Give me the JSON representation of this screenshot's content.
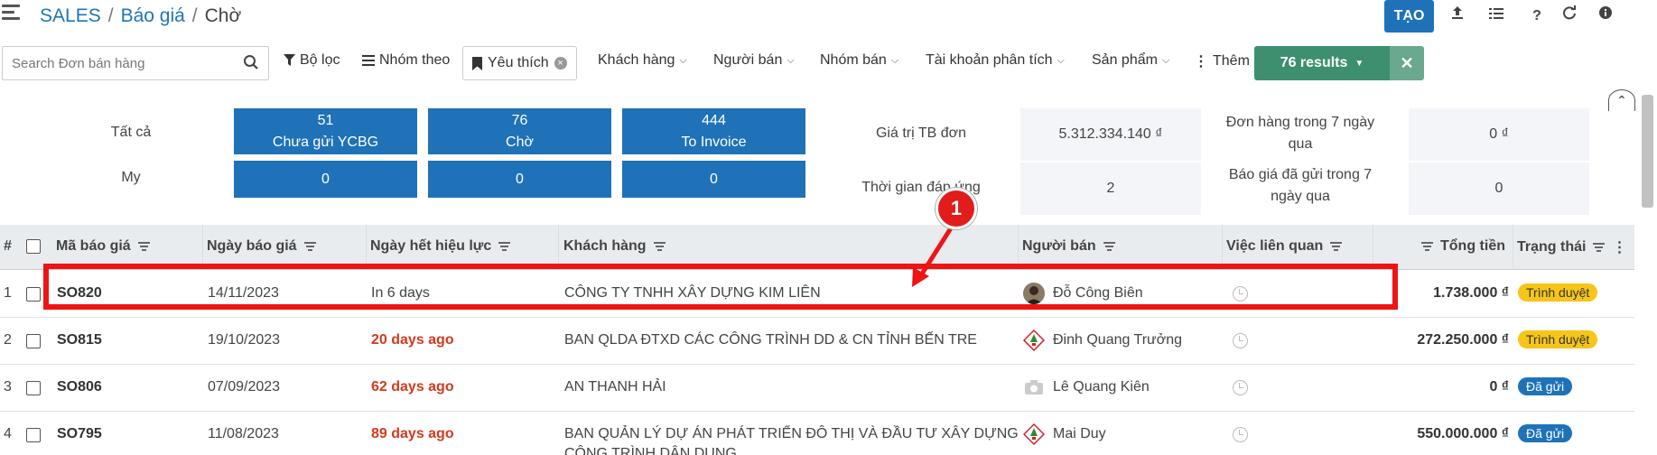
{
  "breadcrumb": {
    "root": "SALES",
    "parent": "Báo giá",
    "current": "Chờ",
    "sep": "/"
  },
  "toolbar": {
    "create_label": "TẠO"
  },
  "search": {
    "placeholder": "Search Đơn bán hàng"
  },
  "filters": {
    "filter_label": "Bộ lọc",
    "group_label": "Nhóm theo",
    "favorite_label": "Yêu thích",
    "customer_label": "Khách hàng",
    "seller_label": "Người bán",
    "team_label": "Nhóm bán",
    "analytic_label": "Tài khoản phân tích",
    "product_label": "Sản phẩm",
    "more_label": "Thêm",
    "results_label": "76 results"
  },
  "dashboard": {
    "row_all": "Tất cả",
    "row_my": "My",
    "tiles": [
      {
        "count": "51",
        "label": "Chưa gửi YCBG",
        "my": "0"
      },
      {
        "count": "76",
        "label": "Chờ",
        "my": "0"
      },
      {
        "count": "444",
        "label": "To Invoice",
        "my": "0"
      }
    ],
    "kpis": [
      {
        "label": "Giá trị TB đơn",
        "value": "5.312.334.140 ₫"
      },
      {
        "label": "Thời gian đáp ứng",
        "value": "2"
      },
      {
        "label_line1": "Đơn hàng trong 7 ngày",
        "label_line2": "qua",
        "value": "0 ₫"
      },
      {
        "label_line1": "Báo giá đã gửi trong 7",
        "label_line2": "ngày qua",
        "value": "0"
      }
    ]
  },
  "table": {
    "headers": {
      "num": "#",
      "code": "Mã báo giá",
      "date": "Ngày báo giá",
      "expiry": "Ngày hết hiệu lực",
      "customer": "Khách hàng",
      "seller": "Người bán",
      "activity": "Việc liên quan",
      "total": "Tổng tiền",
      "status": "Trạng thái"
    },
    "rows": [
      {
        "num": "1",
        "code": "SO820",
        "date": "14/11/2023",
        "expiry": "In 6 days",
        "customer": "CÔNG TY TNHH XÂY DỰNG KIM LIÊN",
        "seller": "Đỗ Công Biên",
        "total": "1.738.000 ₫",
        "status": "Trình duyệt"
      },
      {
        "num": "2",
        "code": "SO815",
        "date": "19/10/2023",
        "expiry": "20 days ago",
        "customer": "BAN QLDA ĐTXD CÁC CÔNG TRÌNH DD & CN TỈNH BẾN TRE",
        "seller": "Đinh Quang Trưởng",
        "total": "272.250.000 ₫",
        "status": "Trình duyệt"
      },
      {
        "num": "3",
        "code": "SO806",
        "date": "07/09/2023",
        "expiry": "62 days ago",
        "customer": "AN THANH HẢI",
        "seller": "Lê Quang Kiên",
        "total": "0 ₫",
        "status": "Đã gửi"
      },
      {
        "num": "4",
        "code": "SO795",
        "date": "11/08/2023",
        "expiry": "89 days ago",
        "customer": "BAN QUẢN LÝ DỰ ÁN PHÁT TRIỂN ĐÔ THỊ VÀ ĐẦU TƯ XÂY DỰNG",
        "customer_line2": "CÔNG TRÌNH DÂN DỤNG",
        "seller": "Mai Duy",
        "total": "550.000.000 ₫",
        "status": "Đã gửi"
      }
    ]
  },
  "annotation": {
    "step": "1"
  },
  "colors": {
    "primary": "#1f72b8",
    "success": "#3d8f6f",
    "warning": "#f5c518",
    "danger": "#d33a1e",
    "highlight": "#ee1414"
  }
}
